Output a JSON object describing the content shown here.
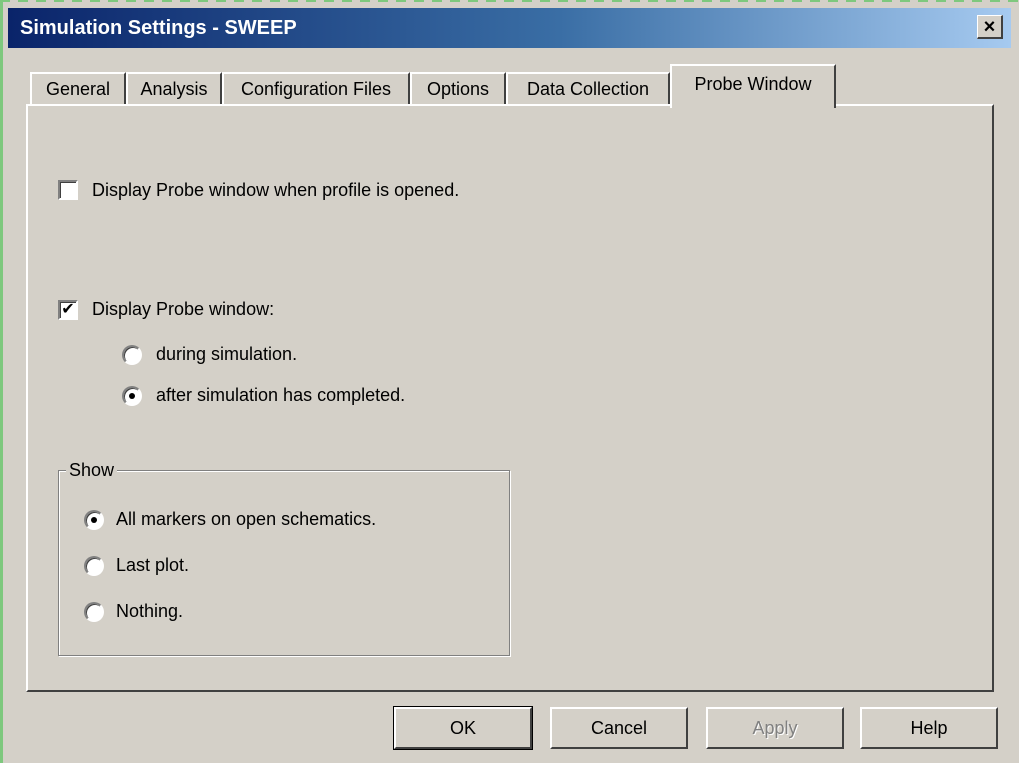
{
  "window": {
    "title": "Simulation Settings - SWEEP",
    "close_glyph": "×"
  },
  "tabs": [
    {
      "label": "General",
      "active": false
    },
    {
      "label": "Analysis",
      "active": false
    },
    {
      "label": "Configuration Files",
      "active": false
    },
    {
      "label": "Options",
      "active": false
    },
    {
      "label": "Data Collection",
      "active": false
    },
    {
      "label": "Probe Window",
      "active": true
    }
  ],
  "probe": {
    "open_on_profile": {
      "label": "Display Probe window when profile is opened.",
      "checked": false
    },
    "display_probe": {
      "label": "Display Probe window:",
      "checked": true
    },
    "during_sim": {
      "label": "during simulation.",
      "selected": false
    },
    "after_sim": {
      "label": "after simulation has completed.",
      "selected": true
    },
    "show_group": {
      "title": "Show",
      "all_markers": {
        "label": "All markers on open schematics.",
        "selected": true
      },
      "last_plot": {
        "label": "Last plot.",
        "selected": false
      },
      "nothing": {
        "label": "Nothing.",
        "selected": false
      }
    }
  },
  "buttons": {
    "ok": "OK",
    "cancel": "Cancel",
    "apply": "Apply",
    "help": "Help"
  },
  "check_glyph": "✔"
}
